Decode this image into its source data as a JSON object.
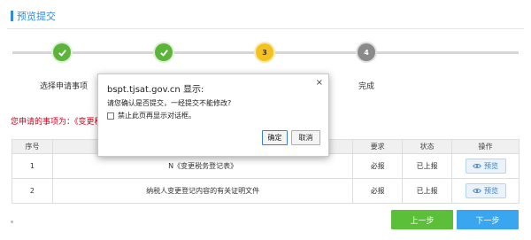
{
  "page": {
    "title": "预览提交"
  },
  "steps": [
    {
      "number": "",
      "label": "选择申请事项",
      "state": "done"
    },
    {
      "number": "",
      "label": "",
      "state": "done"
    },
    {
      "number": "3",
      "label": "",
      "state": "current"
    },
    {
      "number": "4",
      "label": "完成",
      "state": "todo"
    }
  ],
  "matters": {
    "text": "您申请的事项为：《变更税"
  },
  "table": {
    "headers": {
      "index": "序号",
      "name": "",
      "required": "要求",
      "status": "状态",
      "action": "操作"
    },
    "rows": [
      {
        "index": "1",
        "name": "N《变更税务登记表》",
        "required": "必报",
        "status": "已上报",
        "action": "预览"
      },
      {
        "index": "2",
        "name": "纳税人变更登记内容的有关证明文件",
        "required": "必报",
        "status": "已上报",
        "action": "预览"
      }
    ]
  },
  "buttons": {
    "prev": "上一步",
    "next": "下一步"
  },
  "dialog": {
    "title": "bspt.tjsat.gov.cn 显示:",
    "close": "×",
    "message": "请您确认是否提交，一经提交不能修改?",
    "checkbox_label": "禁止此页再显示对话框。",
    "ok": "确定",
    "cancel": "取消"
  }
}
